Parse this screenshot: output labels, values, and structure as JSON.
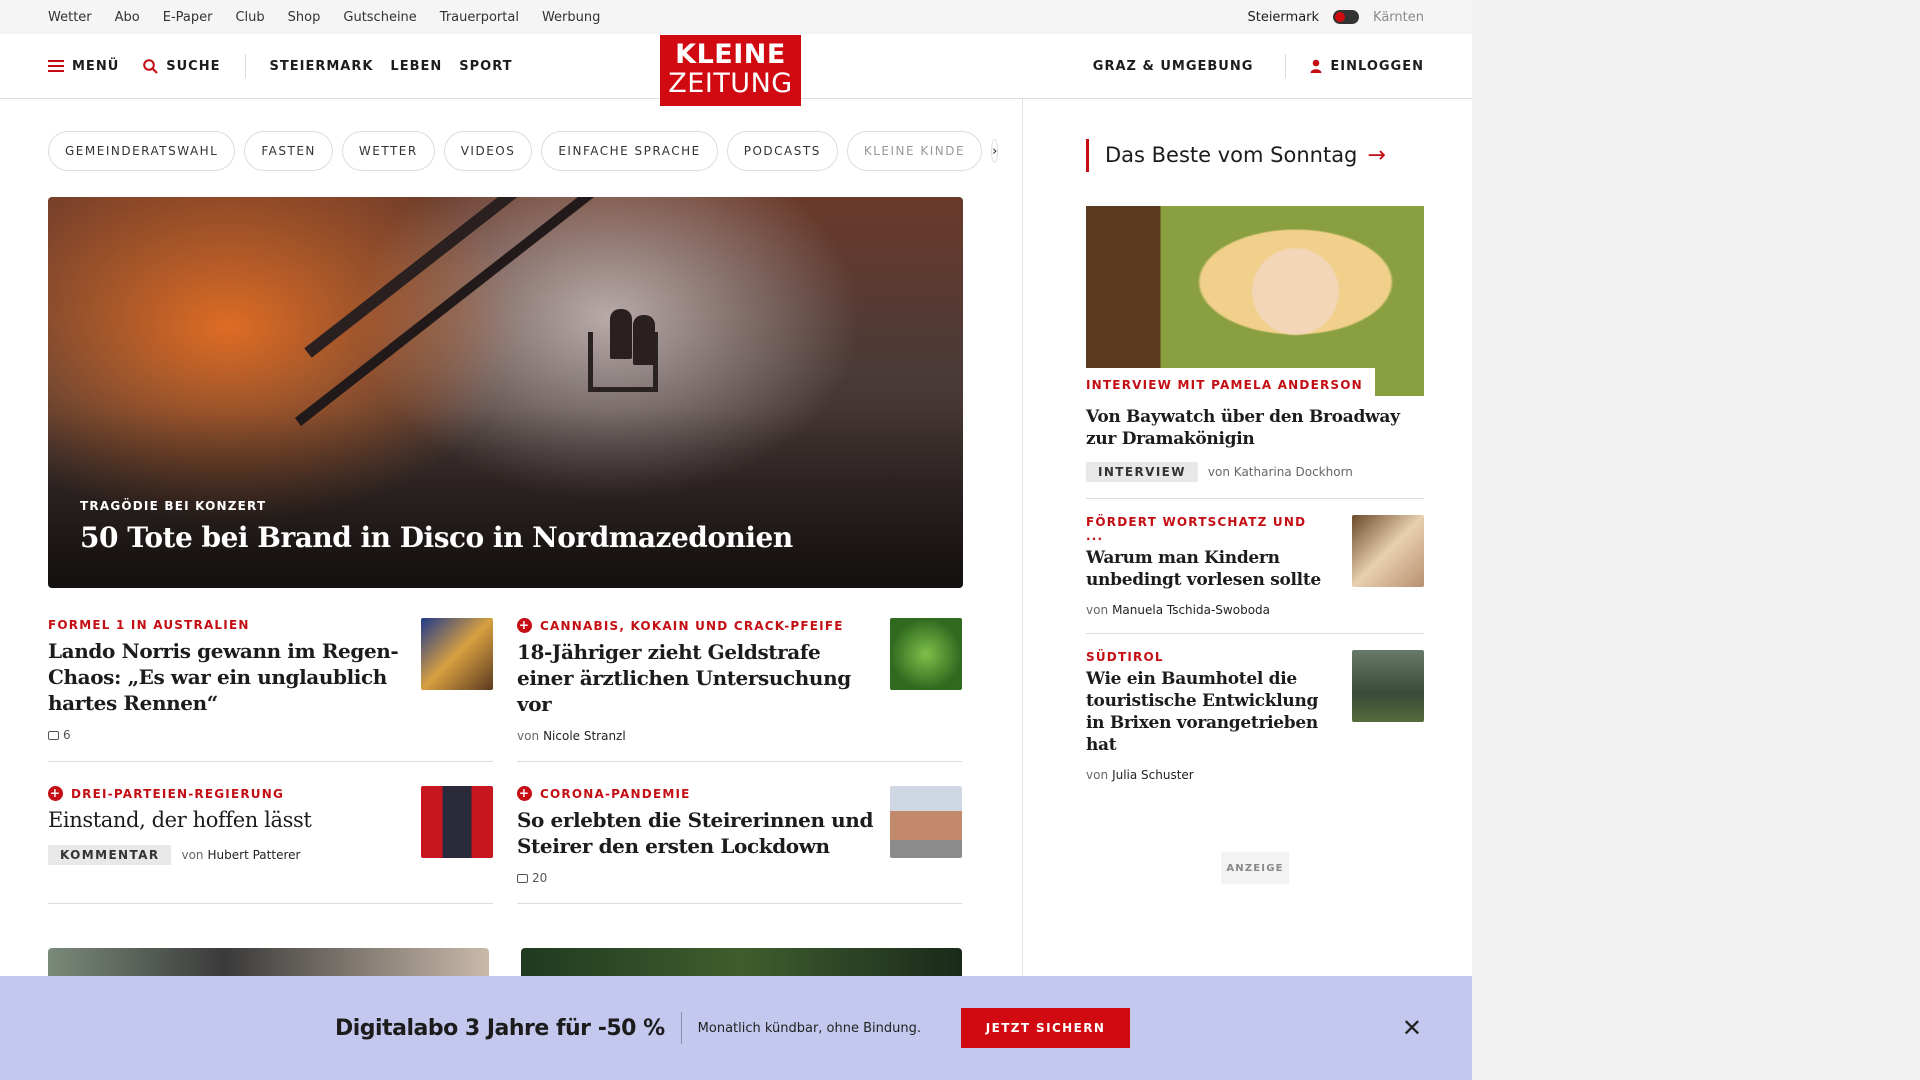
{
  "utility_links": [
    "Wetter",
    "Abo",
    "E-Paper",
    "Club",
    "Shop",
    "Gutscheine",
    "Trauerportal",
    "Werbung"
  ],
  "region": {
    "active": "Steiermark",
    "inactive": "Kärnten"
  },
  "header": {
    "menu": "MENÜ",
    "search": "SUCHE",
    "nav": [
      "STEIERMARK",
      "LEBEN",
      "SPORT"
    ],
    "logo_line1": "KLEINE",
    "logo_line2": "ZEITUNG",
    "local": "GRAZ & UMGEBUNG",
    "login": "EINLOGGEN"
  },
  "chips": [
    "GEMEINDERATSWAHL",
    "FASTEN",
    "WETTER",
    "VIDEOS",
    "EINFACHE SPRACHE",
    "PODCASTS",
    "KLEINE KINDE"
  ],
  "hero": {
    "kicker": "TRAGÖDIE BEI KONZERT",
    "title": "50 Tote bei Brand in Disco in Nordmazedonien"
  },
  "cards": [
    {
      "kicker": "FORMEL 1 IN AUSTRALIEN",
      "title": "Lando Norris gewann im Regen-Chaos: „Es war ein unglaublich hartes Rennen“",
      "comments": "6"
    },
    {
      "kicker": "CANNABIS, KOKAIN UND CRACK-PFEIFE",
      "title": "18-Jähriger zieht Geldstrafe einer ärztlichen Untersuchung vor",
      "by": "von",
      "author": "Nicole Stranzl"
    },
    {
      "kicker": "DREI-PARTEIEN-REGIERUNG",
      "title": "Einstand, der hoffen lässt",
      "badge": "KOMMENTAR",
      "by": "von",
      "author": "Hubert Patterer"
    },
    {
      "kicker": "CORONA-PANDEMIE",
      "title": "So erlebten die Steirerinnen und Steirer den ersten Lockdown",
      "comments": "20"
    }
  ],
  "sidebar": {
    "heading": "Das Beste vom Sonntag",
    "featured": {
      "kicker": "INTERVIEW MIT PAMELA ANDERSON",
      "title": "Von Baywatch über den Broadway zur Dramakönigin",
      "badge": "INTERVIEW",
      "by": "von Katharina Dockhorn"
    },
    "items": [
      {
        "kicker": "FÖRDERT WORTSCHATZ UND ...",
        "title": "Warum man Kindern unbedingt vorlesen sollte",
        "by": "von",
        "author": "Manuela Tschida-Swoboda"
      },
      {
        "kicker": "SÜDTIROL",
        "title": "Wie ein Baumhotel die touristische Entwicklung in Brixen vorangetrieben hat",
        "by": "von",
        "author": "Julia Schuster"
      }
    ],
    "ad_label": "ANZEIGE"
  },
  "promo": {
    "title": "Digitalabo 3 Jahre für -50 %",
    "subtitle": "Monatlich kündbar, ohne Bindung.",
    "button": "JETZT SICHERN"
  },
  "icons": {
    "menu": "hamburger-icon",
    "search": "search-icon",
    "user": "user-icon",
    "close": "close-icon",
    "chevron": "chevron-right-icon",
    "comment": "comment-icon",
    "plus": "plus-icon"
  },
  "colors": {
    "brand_red": "#d10a11",
    "promo_bg": "#c4c8ee"
  }
}
